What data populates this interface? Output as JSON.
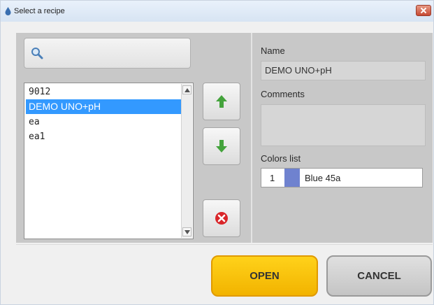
{
  "window": {
    "title": "Select a recipe",
    "title_icon": "app-drop-icon",
    "close_icon": "close-icon"
  },
  "search": {
    "icon": "search-icon",
    "value": ""
  },
  "recipe_list": {
    "items": [
      "9012",
      "DEMO UNO+pH",
      "ea",
      "ea1"
    ],
    "selected": "DEMO UNO+pH"
  },
  "side_buttons": {
    "up_icon": "arrow-up-icon",
    "down_icon": "arrow-down-icon",
    "delete_icon": "delete-icon",
    "colors": {
      "arrow": "#44a33c",
      "delete": "#d9262a"
    }
  },
  "details": {
    "name_label": "Name",
    "name_value": "DEMO UNO+pH",
    "comments_label": "Comments",
    "comments_value": "",
    "colors_label": "Colors list",
    "colors": [
      {
        "index": "1",
        "swatch": "#6f82cf",
        "name": "Blue 45a"
      }
    ]
  },
  "buttons": {
    "open_label": "OPEN",
    "cancel_label": "CANCEL",
    "open_color": "#ffc800"
  }
}
